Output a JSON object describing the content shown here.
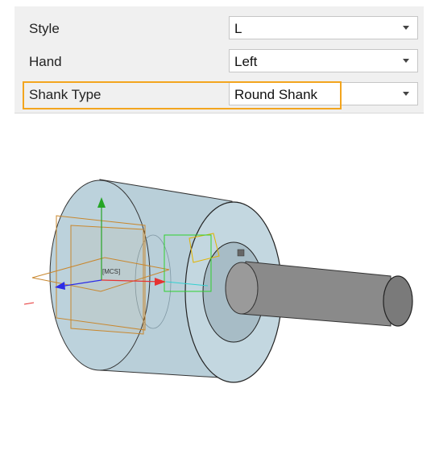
{
  "properties": {
    "rows": [
      {
        "label": "Style",
        "value": "L"
      },
      {
        "label": "Hand",
        "value": "Left"
      },
      {
        "label": "Shank Type",
        "value": "Round Shank"
      }
    ],
    "highlight_color": "#f3a51e"
  },
  "viewport": {
    "csys_label": "[MCS]",
    "model_color": "#b9cfd9",
    "shank_color": "#8a8a8a"
  }
}
